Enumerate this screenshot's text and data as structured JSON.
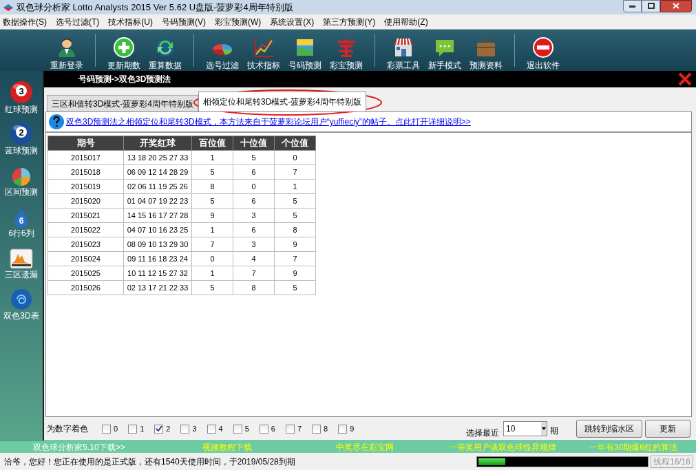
{
  "window": {
    "title": "双色球分析家 Lotto Analysts 2015 Ver 5.62 U盘版-菠萝彩4周年特别版"
  },
  "menu": [
    "数据操作(S)",
    "选号过滤(T)",
    "技术指标(U)",
    "号码预测(V)",
    "彩宝预测(W)",
    "系统设置(X)",
    "第三方预测(Y)",
    "使用帮助(Z)"
  ],
  "toolbar": [
    [
      {
        "label": "重新登录"
      }
    ],
    [
      {
        "label": "更新期数"
      },
      {
        "label": "重算数据"
      }
    ],
    [
      {
        "label": "选号过滤"
      },
      {
        "label": "技术指标"
      },
      {
        "label": "号码预测"
      },
      {
        "label": "彩宝预测"
      }
    ],
    [
      {
        "label": "彩票工具"
      },
      {
        "label": "新手模式"
      },
      {
        "label": "预测资料"
      }
    ],
    [
      {
        "label": "退出软件"
      }
    ]
  ],
  "sidebar": [
    {
      "label": "红球预测",
      "kind": "ball",
      "color": "#d42020",
      "badge": "3"
    },
    {
      "label": "蓝球预测",
      "kind": "ball",
      "color": "#1a4f9a",
      "badge": "2"
    },
    {
      "label": "区间预测",
      "kind": "pie"
    },
    {
      "label": "6行6列",
      "kind": "drop",
      "badge": "6"
    },
    {
      "label": "三区遗漏",
      "kind": "histogram"
    },
    {
      "label": "双色3D表",
      "kind": "swirl"
    }
  ],
  "panel": {
    "title": "号码预测->双色3D预测法"
  },
  "tabs": [
    {
      "label": "三区和值转3D模式-菠萝彩4周年特别版",
      "selected": false
    },
    {
      "label": "相领定位和尾转3D模式-菠萝彩4周年特别版",
      "selected": true
    }
  ],
  "info_link": "双色3D预测法之相领定位和尾转3D模式，本方法来自于菠萝彩论坛用户“yuffieciy”的帖子。点此打开详细说明>>",
  "table": {
    "columns": [
      "期号",
      "开奖红球",
      "百位值",
      "十位值",
      "个位值"
    ],
    "rows": [
      [
        "2015017",
        "13 18 20 25 27 33",
        "1",
        "5",
        "0"
      ],
      [
        "2015018",
        "06 09 12 14 28 29",
        "5",
        "6",
        "7"
      ],
      [
        "2015019",
        "02 06 11 19 25 26",
        "8",
        "0",
        "1"
      ],
      [
        "2015020",
        "01 04 07 19 22 23",
        "5",
        "6",
        "5"
      ],
      [
        "2015021",
        "14 15 16 17 27 28",
        "9",
        "3",
        "5"
      ],
      [
        "2015022",
        "04 07 10 16 23 25",
        "1",
        "6",
        "8"
      ],
      [
        "2015023",
        "08 09 10 13 29 30",
        "7",
        "3",
        "9"
      ],
      [
        "2015024",
        "09 11 16 18 23 24",
        "0",
        "4",
        "7"
      ],
      [
        "2015025",
        "10 11 12 15 27 32",
        "1",
        "7",
        "9"
      ],
      [
        "2015026",
        "02 13 17 21 22 33",
        "5",
        "8",
        "5"
      ]
    ]
  },
  "color_digits": {
    "label": "为数字着色",
    "options": [
      {
        "label": "0",
        "checked": false
      },
      {
        "label": "1",
        "checked": false
      },
      {
        "label": "2",
        "checked": true
      },
      {
        "label": "3",
        "checked": false
      },
      {
        "label": "4",
        "checked": false
      },
      {
        "label": "5",
        "checked": false
      },
      {
        "label": "6",
        "checked": false
      },
      {
        "label": "7",
        "checked": false
      },
      {
        "label": "8",
        "checked": false
      },
      {
        "label": "9",
        "checked": false
      }
    ]
  },
  "recent": {
    "label": "选择最近",
    "value": "10",
    "unit": "期"
  },
  "buttons": [
    "跳转到缩水区",
    "更新"
  ],
  "links": [
    {
      "text": "双色球分析家5.10下载>>",
      "color": "#ffffff"
    },
    {
      "text": "视频教程下载",
      "color": "#ffff00"
    },
    {
      "text": "中奖尽在彩宝网",
      "color": "#ffff00"
    },
    {
      "text": "一等奖用户谈双色球怪异规律",
      "color": "#ffff00"
    },
    {
      "text": "一年有30期爆6红的算法",
      "color": "#ffff00"
    }
  ],
  "status": {
    "text": "洽爷，您好！您正在使用的是正式版，还有1540天使用时间，于2019/05/28到期",
    "level": 0.16,
    "thread": "线程16/16",
    "thread_disabled": true
  }
}
